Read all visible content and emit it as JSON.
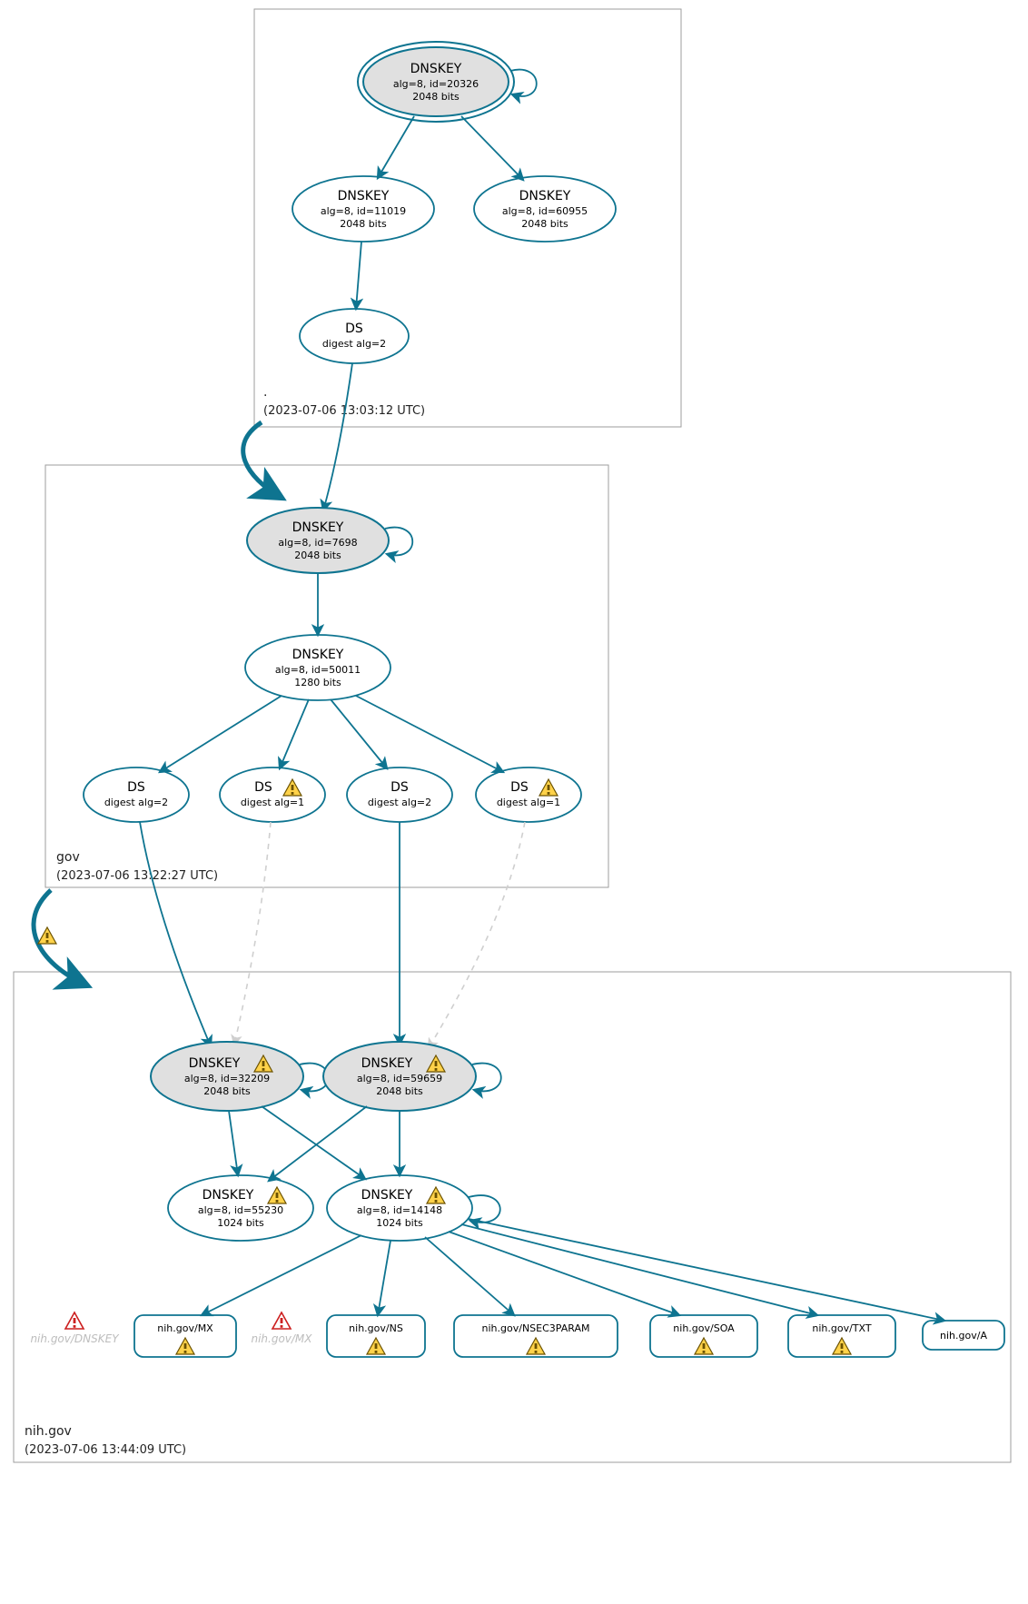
{
  "zones": {
    "root": {
      "label": ".",
      "timestamp": "(2023-07-06 13:03:12 UTC)"
    },
    "gov": {
      "label": "gov",
      "timestamp": "(2023-07-06 13:22:27 UTC)"
    },
    "nih": {
      "label": "nih.gov",
      "timestamp": "(2023-07-06 13:44:09 UTC)"
    }
  },
  "nodes": {
    "root_ksk": {
      "title": "DNSKEY",
      "l1": "alg=8, id=20326",
      "l2": "2048 bits"
    },
    "root_zsk1": {
      "title": "DNSKEY",
      "l1": "alg=8, id=11019",
      "l2": "2048 bits"
    },
    "root_zsk2": {
      "title": "DNSKEY",
      "l1": "alg=8, id=60955",
      "l2": "2048 bits"
    },
    "root_ds": {
      "title": "DS",
      "l1": "digest alg=2"
    },
    "gov_ksk": {
      "title": "DNSKEY",
      "l1": "alg=8, id=7698",
      "l2": "2048 bits"
    },
    "gov_zsk": {
      "title": "DNSKEY",
      "l1": "alg=8, id=50011",
      "l2": "1280 bits"
    },
    "gov_ds1": {
      "title": "DS",
      "l1": "digest alg=2"
    },
    "gov_ds2": {
      "title": "DS",
      "l1": "digest alg=1"
    },
    "gov_ds3": {
      "title": "DS",
      "l1": "digest alg=2"
    },
    "gov_ds4": {
      "title": "DS",
      "l1": "digest alg=1"
    },
    "nih_ksk1": {
      "title": "DNSKEY",
      "l1": "alg=8, id=32209",
      "l2": "2048 bits"
    },
    "nih_ksk2": {
      "title": "DNSKEY",
      "l1": "alg=8, id=59659",
      "l2": "2048 bits"
    },
    "nih_zsk1": {
      "title": "DNSKEY",
      "l1": "alg=8, id=55230",
      "l2": "1024 bits"
    },
    "nih_zsk2": {
      "title": "DNSKEY",
      "l1": "alg=8, id=14148",
      "l2": "1024 bits"
    }
  },
  "rr": {
    "mx": "nih.gov/MX",
    "ns": "nih.gov/NS",
    "nsec3": "nih.gov/NSEC3PARAM",
    "soa": "nih.gov/SOA",
    "txt": "nih.gov/TXT",
    "a": "nih.gov/A"
  },
  "ghosts": {
    "dnskey": "nih.gov/DNSKEY",
    "mx": "nih.gov/MX"
  }
}
